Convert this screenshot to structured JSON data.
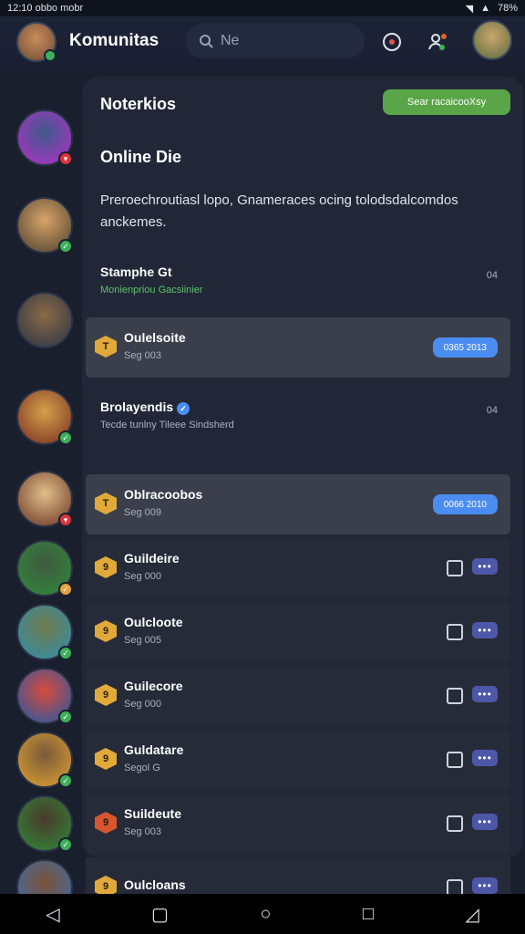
{
  "status": {
    "time": "12:10 obbo mobr",
    "battery": "78%"
  },
  "header": {
    "title": "Komunitas",
    "search_placeholder": "Ne"
  },
  "panel": {
    "title": "Noterkios",
    "action_button": "Sear racaicooXsy",
    "section": "Online Die",
    "description": "Preroechroutiasl lopo, Gnameraces ocing tolodsdalcomdos anckemes."
  },
  "rows": [
    {
      "name": "Stamphe Gt",
      "subtitle": "Monienpriou Gacsiinier",
      "time": "04",
      "style": "plain"
    },
    {
      "name": "Oulelsoite",
      "subtitle": "Seg 003",
      "pill": "0365 2013",
      "style": "hl"
    },
    {
      "name": "Brolayendis",
      "subtitle": "Tecde tunlny Tileee Sindsherd",
      "time": "04",
      "style": "plain"
    },
    {
      "name": "Oblracoobos",
      "subtitle": "Seg 009",
      "pill": "0066 2010",
      "style": "hl"
    },
    {
      "name": "Guildeire",
      "subtitle": "Seg 000",
      "style": "dark"
    },
    {
      "name": "Oulcloote",
      "subtitle": "Seg 005",
      "style": "dark"
    },
    {
      "name": "Guilecore",
      "subtitle": "Seg 000",
      "style": "dark"
    },
    {
      "name": "Guldatare",
      "subtitle": "Segol G",
      "style": "dark"
    },
    {
      "name": "Suildeute",
      "subtitle": "Seg 003",
      "style": "dark"
    },
    {
      "name": "Oulcloans",
      "subtitle": "",
      "style": "dark"
    }
  ],
  "colors": {
    "accent_green": "#5aa547",
    "accent_blue": "#4b8cf1",
    "panel": "#222737",
    "bg": "#1a1f2e"
  }
}
